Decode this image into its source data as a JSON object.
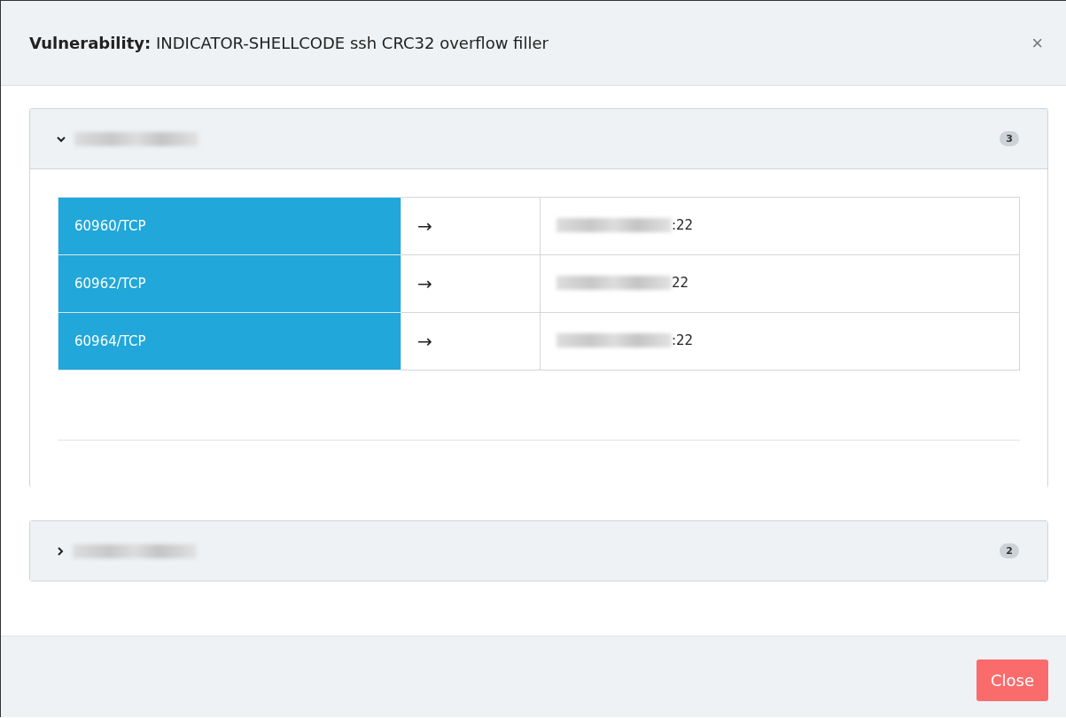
{
  "dialog": {
    "title_label": "Vulnerability:",
    "title": "INDICATOR-SHELLCODE ssh CRC32 overflow filler",
    "close_symbol": "×"
  },
  "panels": [
    {
      "expanded": true,
      "title_redacted": true,
      "count": "3",
      "rows": [
        {
          "source": "60960/TCP",
          "arrow": "→",
          "host_redacted": true,
          "port": ":22"
        },
        {
          "source": "60962/TCP",
          "arrow": "→",
          "host_redacted": true,
          "port": "22"
        },
        {
          "source": "60964/TCP",
          "arrow": "→",
          "host_redacted": true,
          "port": ":22"
        }
      ]
    },
    {
      "expanded": false,
      "title_redacted": true,
      "count": "2"
    }
  ],
  "footer": {
    "close_button": "Close"
  }
}
